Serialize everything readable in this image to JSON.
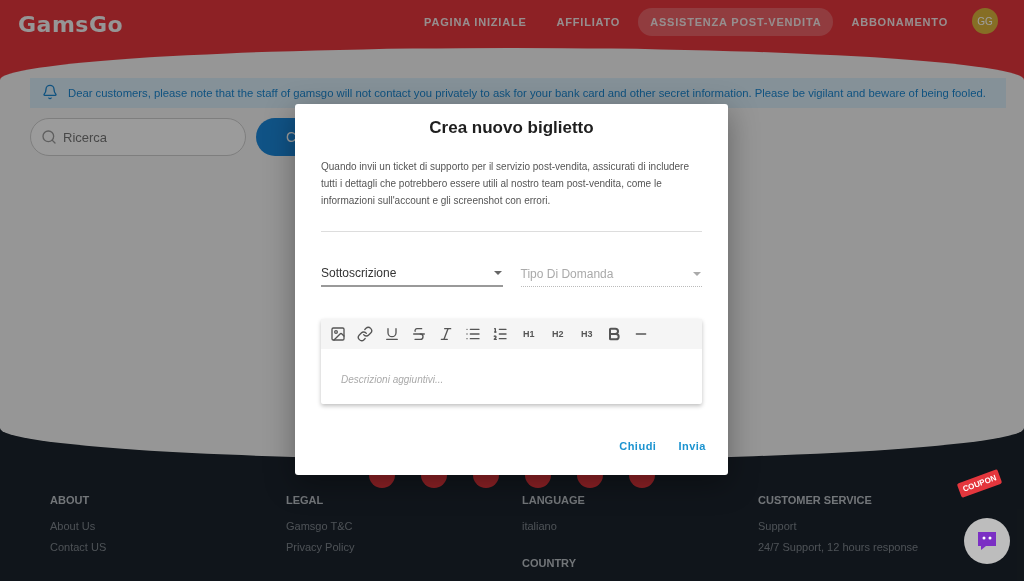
{
  "header": {
    "logo": "GamsGo",
    "nav": [
      {
        "label": "PAGINA INIZIALE",
        "selected": false
      },
      {
        "label": "AFFILIATO",
        "selected": false
      },
      {
        "label": "ASSISTENZA POST-VENDITA",
        "selected": true
      },
      {
        "label": "ABBONAMENTO",
        "selected": false
      }
    ],
    "avatar": "GG"
  },
  "notice": "Dear customers, please note that the staff of gamsgo will not contact you privately to ask for your bank card and other secret information. Please be vigilant and beware of being fooled.",
  "search": {
    "placeholder": "Ricerca"
  },
  "create_button": "C",
  "dialog": {
    "title": "Crea nuovo biglietto",
    "description": "Quando invii un ticket di supporto per il servizio post-vendita, assicurati di includere tutti i dettagli che potrebbero essere utili al nostro team post-vendita, come le informazioni sull'account e gli screenshot con errori.",
    "selects": [
      {
        "label": "Sottoscrizione",
        "disabled": false
      },
      {
        "label": "Tipo Di Domanda",
        "disabled": true
      }
    ],
    "toolbar": [
      {
        "kind": "image"
      },
      {
        "kind": "link"
      },
      {
        "kind": "underline"
      },
      {
        "kind": "strike"
      },
      {
        "kind": "italic"
      },
      {
        "kind": "bullets"
      },
      {
        "kind": "numbers"
      },
      {
        "kind": "text",
        "label": "H1"
      },
      {
        "kind": "text",
        "label": "H2"
      },
      {
        "kind": "text",
        "label": "H3"
      },
      {
        "kind": "bold"
      },
      {
        "kind": "rule"
      }
    ],
    "editor_placeholder": "Descrizioni aggiuntivi...",
    "actions": [
      "Chiudi",
      "Invia"
    ]
  },
  "footer": {
    "columns": [
      {
        "sections": [
          {
            "heading": "ABOUT",
            "links": [
              "About Us",
              "Contact US"
            ]
          }
        ]
      },
      {
        "sections": [
          {
            "heading": "LEGAL",
            "links": [
              "Gamsgo T&C",
              "Privacy Policy"
            ]
          }
        ]
      },
      {
        "sections": [
          {
            "heading": "LANGUAGE",
            "links": [
              "italiano"
            ]
          },
          {
            "heading": "COUNTRY"
          }
        ]
      },
      {
        "sections": [
          {
            "heading": "CUSTOMER SERVICE",
            "links": [
              "Support",
              "24/7 Support, 12 hours response"
            ]
          }
        ]
      }
    ]
  },
  "coupon": "COUPON"
}
